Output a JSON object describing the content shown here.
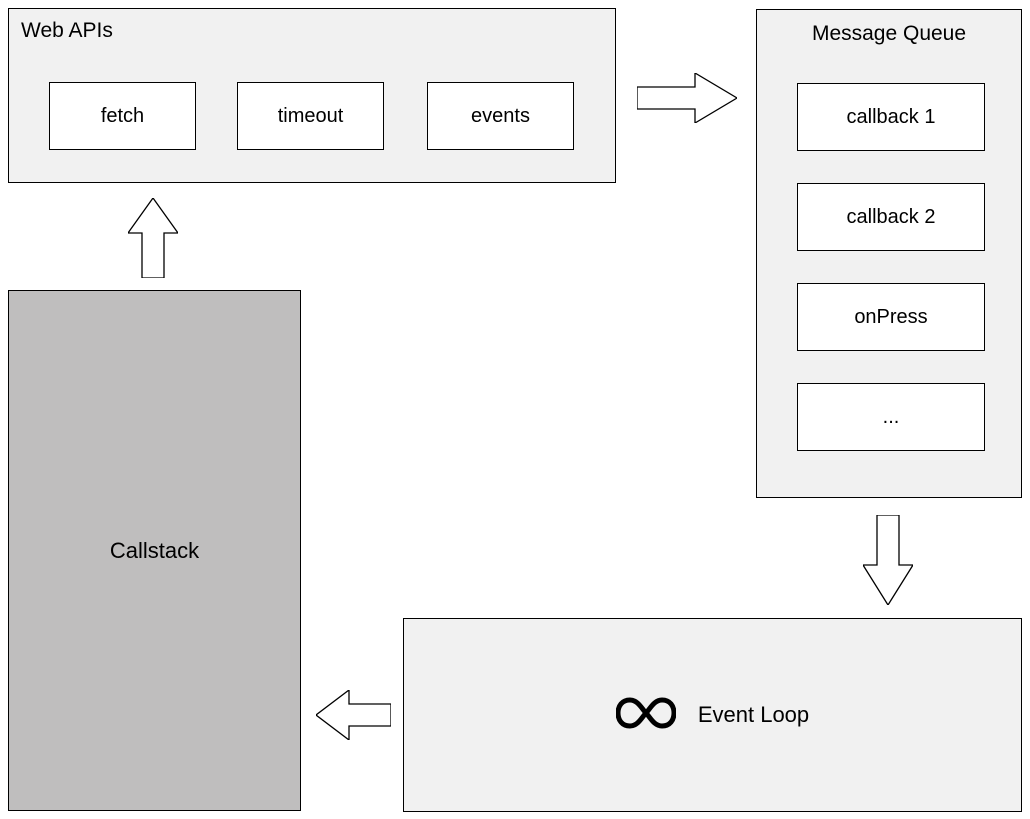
{
  "webApis": {
    "title": "Web APIs",
    "items": [
      "fetch",
      "timeout",
      "events"
    ]
  },
  "messageQueue": {
    "title": "Message Queue",
    "items": [
      "callback 1",
      "callback 2",
      "onPress",
      "..."
    ]
  },
  "callstack": {
    "title": "Callstack"
  },
  "eventLoop": {
    "title": "Event Loop"
  }
}
